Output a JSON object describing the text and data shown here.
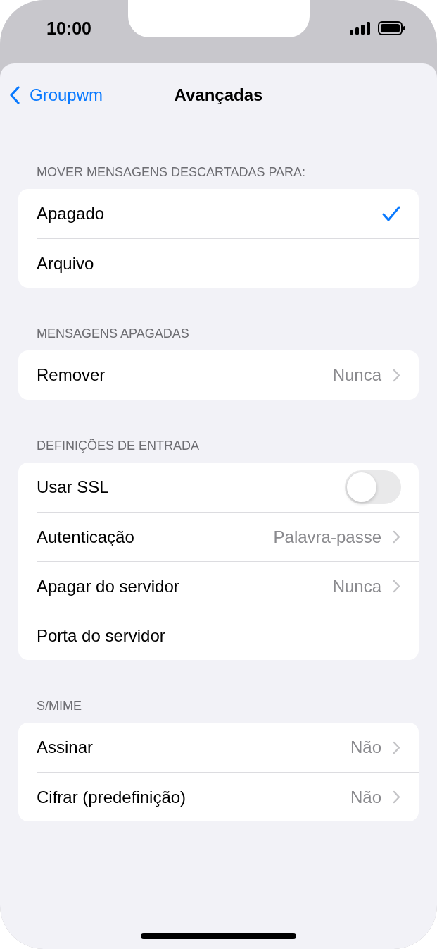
{
  "status_bar": {
    "time": "10:00"
  },
  "nav": {
    "back": "Groupwm",
    "title": "Avançadas"
  },
  "sections": [
    {
      "header": "MOVER MENSAGENS DESCARTADAS PARA:",
      "rows": [
        {
          "kind": "check",
          "label": "Apagado",
          "selected": true
        },
        {
          "kind": "check",
          "label": "Arquivo",
          "selected": false
        }
      ]
    },
    {
      "header": "MENSAGENS APAGADAS",
      "rows": [
        {
          "kind": "value",
          "label": "Remover",
          "value": "Nunca"
        }
      ]
    },
    {
      "header": "DEFINIÇÕES DE ENTRADA",
      "rows": [
        {
          "kind": "toggle",
          "label": "Usar SSL",
          "on": false
        },
        {
          "kind": "value",
          "label": "Autenticação",
          "value": "Palavra-passe"
        },
        {
          "kind": "value",
          "label": "Apagar do servidor",
          "value": "Nunca"
        },
        {
          "kind": "plain",
          "label": "Porta do servidor"
        }
      ]
    },
    {
      "header": "S/MIME",
      "rows": [
        {
          "kind": "value",
          "label": "Assinar",
          "value": "Não"
        },
        {
          "kind": "value",
          "label": "Cifrar (predefinição)",
          "value": "Não"
        }
      ]
    }
  ]
}
